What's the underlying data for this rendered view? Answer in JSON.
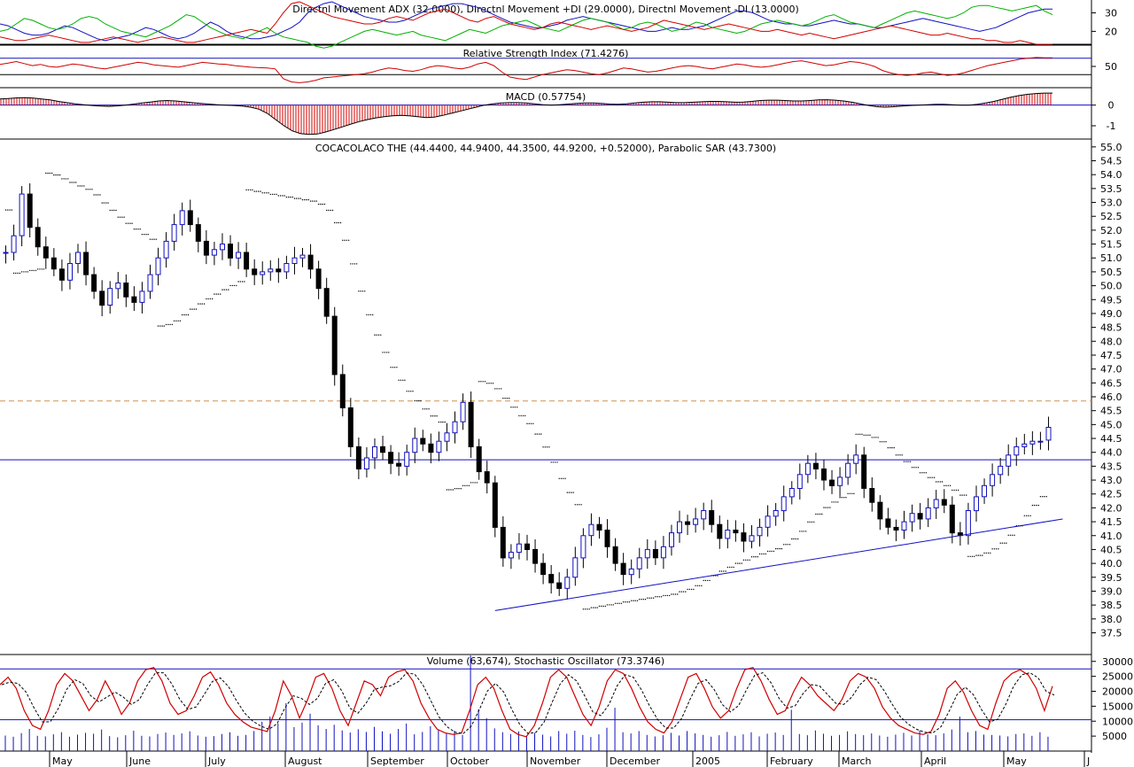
{
  "colors": {
    "blue": "#1010c0",
    "red": "#d00000",
    "green": "#00b000",
    "orange": "#d09050"
  },
  "months": [
    "May",
    "June",
    "July",
    "August",
    "September",
    "October",
    "November",
    "December",
    "2005",
    "February",
    "March",
    "April",
    "May",
    "J"
  ],
  "chart_data": [
    {
      "panel": "adx",
      "type": "line",
      "title": "Directnl Movement ADX (32.0000), Directnl Movement +DI (29.0000), Directnl Movement -DI (13.0000)",
      "ylim": [
        13,
        36
      ],
      "yticks": [
        "30",
        "20"
      ],
      "series": [
        {
          "name": "ADX",
          "color": "blue",
          "values": [
            24,
            23,
            21,
            19,
            18,
            18,
            19,
            21,
            23,
            22,
            20,
            18,
            16,
            15,
            16,
            17,
            18,
            20,
            22,
            21,
            19,
            17,
            16,
            17,
            19,
            22,
            25,
            23,
            20,
            18,
            17,
            16,
            16,
            17,
            18,
            20,
            22,
            25,
            30,
            33,
            35,
            36,
            34,
            32,
            30,
            28,
            27,
            26,
            25,
            25,
            26,
            28,
            30,
            32,
            33,
            34,
            35,
            35,
            34,
            33,
            31,
            29,
            27,
            25,
            24,
            23,
            22,
            22,
            23,
            24,
            26,
            27,
            28,
            27,
            26,
            25,
            24,
            23,
            22,
            21,
            20,
            20,
            21,
            22,
            21,
            21,
            22,
            23,
            25,
            27,
            29,
            31,
            31,
            30,
            28,
            26,
            25,
            24,
            24,
            23,
            23,
            24,
            25,
            26,
            25,
            24,
            24,
            23,
            22,
            22,
            23,
            24,
            25,
            26,
            27,
            26,
            25,
            24,
            23,
            22,
            21,
            20,
            21,
            22,
            24,
            26,
            28,
            30,
            31,
            32,
            32
          ]
        },
        {
          "name": "+DI",
          "color": "green",
          "values": [
            20,
            21,
            24,
            27,
            26,
            24,
            22,
            21,
            22,
            24,
            27,
            28,
            27,
            24,
            22,
            20,
            19,
            18,
            17,
            19,
            21,
            23,
            26,
            29,
            28,
            25,
            22,
            20,
            18,
            17,
            16,
            18,
            20,
            22,
            19,
            17,
            16,
            15,
            14,
            12,
            11,
            12,
            14,
            16,
            18,
            20,
            21,
            20,
            19,
            18,
            19,
            20,
            18,
            17,
            16,
            15,
            17,
            19,
            21,
            20,
            19,
            21,
            23,
            24,
            25,
            26,
            24,
            22,
            21,
            20,
            22,
            24,
            26,
            27,
            26,
            25,
            23,
            21,
            22,
            24,
            25,
            24,
            22,
            20,
            21,
            23,
            25,
            24,
            22,
            21,
            20,
            19,
            20,
            22,
            24,
            25,
            26,
            25,
            24,
            23,
            24,
            26,
            28,
            29,
            27,
            25,
            24,
            23,
            22,
            24,
            26,
            28,
            30,
            31,
            30,
            29,
            28,
            27,
            28,
            30,
            33,
            34,
            34,
            33,
            32,
            31,
            32,
            33,
            34,
            31,
            29
          ]
        },
        {
          "name": "-DI",
          "color": "red",
          "values": [
            17,
            16,
            15,
            15,
            16,
            17,
            18,
            17,
            16,
            15,
            14,
            14,
            15,
            16,
            17,
            16,
            15,
            14,
            15,
            16,
            17,
            16,
            15,
            14,
            14,
            15,
            16,
            17,
            18,
            19,
            20,
            21,
            20,
            19,
            24,
            30,
            35,
            36,
            34,
            32,
            30,
            28,
            27,
            26,
            25,
            24,
            24,
            25,
            27,
            28,
            27,
            26,
            28,
            30,
            31,
            32,
            30,
            28,
            26,
            25,
            27,
            28,
            26,
            24,
            23,
            22,
            21,
            22,
            24,
            25,
            24,
            23,
            22,
            21,
            22,
            23,
            22,
            21,
            20,
            21,
            22,
            24,
            26,
            25,
            24,
            23,
            22,
            21,
            22,
            23,
            24,
            23,
            22,
            21,
            20,
            20,
            21,
            20,
            19,
            18,
            19,
            18,
            17,
            16,
            17,
            18,
            19,
            20,
            21,
            22,
            23,
            22,
            21,
            20,
            19,
            18,
            18,
            19,
            18,
            17,
            16,
            16,
            15,
            15,
            14,
            14,
            15,
            14,
            13,
            13,
            13
          ]
        }
      ]
    },
    {
      "panel": "rsi",
      "type": "line",
      "title": "Relative Strength Index (71.4276)",
      "ylim": [
        0,
        100
      ],
      "yticks": [
        "50"
      ],
      "levels": [
        70,
        30
      ],
      "series": [
        {
          "name": "RSI",
          "color": "red",
          "values": [
            55,
            58,
            62,
            57,
            52,
            55,
            50,
            48,
            52,
            56,
            54,
            50,
            46,
            44,
            48,
            52,
            56,
            60,
            58,
            54,
            52,
            50,
            48,
            52,
            56,
            60,
            58,
            56,
            55,
            52,
            50,
            48,
            47,
            46,
            44,
            20,
            12,
            10,
            12,
            16,
            22,
            24,
            26,
            28,
            30,
            32,
            36,
            42,
            46,
            44,
            40,
            38,
            42,
            48,
            52,
            50,
            46,
            44,
            48,
            56,
            60,
            52,
            36,
            24,
            20,
            18,
            24,
            30,
            34,
            38,
            42,
            40,
            36,
            32,
            30,
            34,
            40,
            46,
            44,
            40,
            36,
            38,
            42,
            46,
            50,
            52,
            50,
            46,
            44,
            48,
            52,
            56,
            54,
            50,
            48,
            50,
            54,
            58,
            62,
            64,
            60,
            56,
            52,
            54,
            58,
            62,
            60,
            56,
            50,
            40,
            34,
            30,
            28,
            30,
            34,
            36,
            32,
            28,
            30,
            34,
            40,
            46,
            52,
            56,
            60,
            64,
            68,
            70,
            72,
            71,
            71
          ]
        }
      ]
    },
    {
      "panel": "macd",
      "type": "line",
      "title": "MACD (0.57754)",
      "ylim": [
        -1.6,
        0.8
      ],
      "yticks": [
        "0",
        "-1"
      ],
      "series": [
        {
          "name": "MACD",
          "color": "black",
          "values": [
            0.3,
            0.32,
            0.35,
            0.36,
            0.34,
            0.3,
            0.25,
            0.18,
            0.12,
            0.06,
            0.02,
            -0.02,
            -0.05,
            -0.06,
            -0.04,
            0.0,
            0.05,
            0.1,
            0.15,
            0.2,
            0.22,
            0.2,
            0.16,
            0.12,
            0.08,
            0.05,
            0.02,
            0.0,
            -0.02,
            -0.05,
            -0.1,
            -0.2,
            -0.4,
            -0.7,
            -1.0,
            -1.25,
            -1.38,
            -1.42,
            -1.4,
            -1.3,
            -1.18,
            -1.05,
            -0.92,
            -0.8,
            -0.7,
            -0.62,
            -0.56,
            -0.52,
            -0.5,
            -0.52,
            -0.56,
            -0.6,
            -0.58,
            -0.5,
            -0.4,
            -0.3,
            -0.2,
            -0.1,
            0.0,
            0.06,
            0.1,
            0.12,
            0.12,
            0.1,
            0.06,
            0.02,
            0.0,
            0.02,
            0.05,
            0.08,
            0.1,
            0.1,
            0.08,
            0.05,
            0.04,
            0.06,
            0.1,
            0.14,
            0.16,
            0.16,
            0.14,
            0.12,
            0.12,
            0.14,
            0.16,
            0.18,
            0.18,
            0.16,
            0.14,
            0.15,
            0.18,
            0.22,
            0.24,
            0.24,
            0.22,
            0.2,
            0.2,
            0.22,
            0.25,
            0.26,
            0.24,
            0.2,
            0.14,
            0.06,
            -0.02,
            -0.08,
            -0.1,
            -0.08,
            -0.05,
            -0.02,
            0.0,
            0.02,
            0.04,
            0.04,
            0.02,
            0.0,
            0.0,
            0.04,
            0.1,
            0.18,
            0.28,
            0.38,
            0.46,
            0.52,
            0.56,
            0.58,
            0.58
          ]
        }
      ]
    },
    {
      "panel": "price",
      "type": "candlestick",
      "title": "COCACOLACO THE (44.4400, 44.9400, 44.3500, 44.9200, +0.52000), Parabolic SAR (43.7300)",
      "ylim": [
        36.75,
        55.25
      ],
      "yticks": [
        "55.0",
        "54.5",
        "54.0",
        "53.5",
        "53.0",
        "52.5",
        "52.0",
        "51.5",
        "51.0",
        "50.5",
        "50.0",
        "49.5",
        "49.0",
        "48.5",
        "48.0",
        "47.5",
        "47.0",
        "46.5",
        "46.0",
        "45.5",
        "45.0",
        "44.5",
        "44.0",
        "43.5",
        "43.0",
        "42.5",
        "42.0",
        "41.5",
        "41.0",
        "40.5",
        "40.0",
        "39.5",
        "39.0",
        "38.5",
        "38.0",
        "37.5"
      ],
      "closes": [
        51.2,
        51.8,
        53.3,
        52.1,
        51.4,
        51.0,
        50.6,
        50.2,
        50.8,
        51.2,
        50.4,
        49.8,
        49.3,
        49.9,
        50.1,
        49.6,
        49.4,
        49.8,
        50.4,
        51.0,
        51.6,
        52.2,
        52.7,
        52.2,
        51.6,
        51.1,
        51.3,
        51.5,
        51.0,
        51.2,
        50.6,
        50.4,
        50.5,
        50.6,
        50.5,
        50.8,
        51.0,
        51.1,
        50.6,
        49.9,
        48.9,
        46.8,
        45.6,
        44.2,
        43.4,
        43.8,
        44.2,
        44.0,
        43.6,
        43.5,
        44.0,
        44.5,
        44.3,
        44.0,
        44.4,
        44.7,
        45.1,
        45.8,
        44.2,
        43.3,
        42.9,
        41.3,
        40.2,
        40.4,
        40.7,
        40.5,
        40.0,
        39.6,
        39.3,
        39.1,
        39.5,
        40.2,
        41.0,
        41.4,
        41.2,
        40.6,
        40.0,
        39.6,
        39.8,
        40.2,
        40.5,
        40.2,
        40.6,
        41.1,
        41.5,
        41.4,
        41.6,
        41.9,
        41.4,
        40.9,
        41.2,
        41.1,
        40.8,
        41.0,
        41.3,
        41.7,
        41.9,
        42.4,
        42.7,
        43.2,
        43.6,
        43.4,
        43.0,
        42.8,
        43.1,
        43.6,
        43.9,
        42.7,
        42.2,
        41.6,
        41.3,
        41.2,
        41.5,
        41.8,
        41.6,
        42.0,
        42.3,
        42.1,
        41.1,
        41.0,
        41.9,
        42.4,
        42.8,
        43.2,
        43.5,
        43.9,
        44.2,
        44.3,
        44.4,
        44.4,
        44.9
      ],
      "last_open": 44.44,
      "sar_level": 43.73,
      "hline_dashed": 45.85,
      "trendline": [
        {
          "day": 0,
          "price": 38.3
        },
        {
          "day": 1,
          "price": 41.6
        }
      ],
      "series": [
        {
          "name": "Parabolic SAR",
          "color": "black"
        }
      ]
    },
    {
      "panel": "stoch_volume",
      "type": "line",
      "title": "Volume (63,674), Stochastic Oscillator (73.3746)",
      "ylim": [
        0,
        32000
      ],
      "yticks": [
        "30000",
        "25000",
        "20000",
        "15000",
        "10000",
        "5000"
      ],
      "levels": [
        27500,
        10500
      ],
      "series": [
        {
          "name": "%K",
          "color": "red",
          "values": [
            75,
            85,
            70,
            40,
            20,
            15,
            40,
            75,
            90,
            80,
            60,
            40,
            55,
            80,
            60,
            35,
            50,
            80,
            95,
            98,
            80,
            50,
            35,
            40,
            60,
            85,
            92,
            75,
            50,
            35,
            25,
            18,
            15,
            12,
            40,
            80,
            60,
            30,
            55,
            85,
            90,
            70,
            40,
            20,
            50,
            80,
            75,
            60,
            85,
            92,
            95,
            80,
            50,
            30,
            15,
            10,
            8,
            10,
            40,
            75,
            85,
            70,
            40,
            15,
            8,
            5,
            20,
            50,
            85,
            95,
            85,
            60,
            35,
            20,
            45,
            80,
            95,
            90,
            70,
            45,
            25,
            15,
            10,
            25,
            55,
            85,
            90,
            70,
            45,
            30,
            40,
            70,
            95,
            98,
            80,
            55,
            35,
            40,
            65,
            85,
            75,
            60,
            50,
            40,
            55,
            80,
            90,
            85,
            70,
            45,
            30,
            20,
            15,
            10,
            8,
            12,
            35,
            70,
            80,
            65,
            40,
            20,
            15,
            50,
            80,
            90,
            95,
            88,
            70,
            40,
            73
          ]
        }
      ],
      "volume": [
        5200,
        4800,
        6000,
        7400,
        5100,
        4900,
        5600,
        6300,
        4800,
        5500,
        6100,
        5800,
        7200,
        5000,
        4600,
        5300,
        6800,
        5100,
        4900,
        5700,
        6200,
        5400,
        5900,
        6600,
        5200,
        4800,
        5000,
        5700,
        6300,
        5100,
        5400,
        6700,
        9800,
        11500,
        9200,
        16000,
        8000,
        9500,
        12500,
        8600,
        7400,
        8800,
        6900,
        6200,
        7300,
        6400,
        8100,
        6600,
        5800,
        7400,
        9200,
        5600,
        6400,
        8300,
        7100,
        5900,
        6800,
        5400,
        32000,
        14000,
        11000,
        7600,
        6300,
        5700,
        6600,
        5200,
        6100,
        5500,
        4900,
        6700,
        5800,
        6800,
        5400,
        4700,
        5600,
        7800,
        14500,
        6300,
        5900,
        6700,
        5400,
        4900,
        5300,
        6100,
        5200,
        6700,
        5900,
        5400,
        4800,
        5300,
        6400,
        5100,
        5600,
        6300,
        4900,
        5800,
        6200,
        5400,
        13800,
        5700,
        5300,
        6900,
        5800,
        5100,
        5400,
        6600,
        5700,
        5300,
        5900,
        5200,
        4800,
        5500,
        6100,
        5200,
        6900,
        5600,
        5300,
        5900,
        7200,
        11500,
        6300,
        6700,
        5500,
        5400,
        5200,
        4900,
        5700,
        5900,
        5100,
        6300,
        4800
      ]
    }
  ]
}
